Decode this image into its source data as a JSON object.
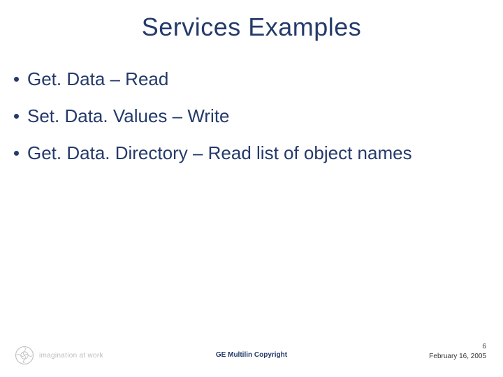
{
  "title": "Services Examples",
  "bullets": [
    "Get. Data – Read",
    "Set. Data. Values – Write",
    "Get. Data. Directory – Read list of object names"
  ],
  "footer": {
    "tagline": "imagination at work",
    "copyright": "GE Multilin Copyright",
    "page": "6",
    "date": "February 16, 2005"
  },
  "icons": {
    "ge_logo": "ge-monogram"
  },
  "colors": {
    "primary": "#243a6b",
    "muted": "#bdbdbd"
  }
}
